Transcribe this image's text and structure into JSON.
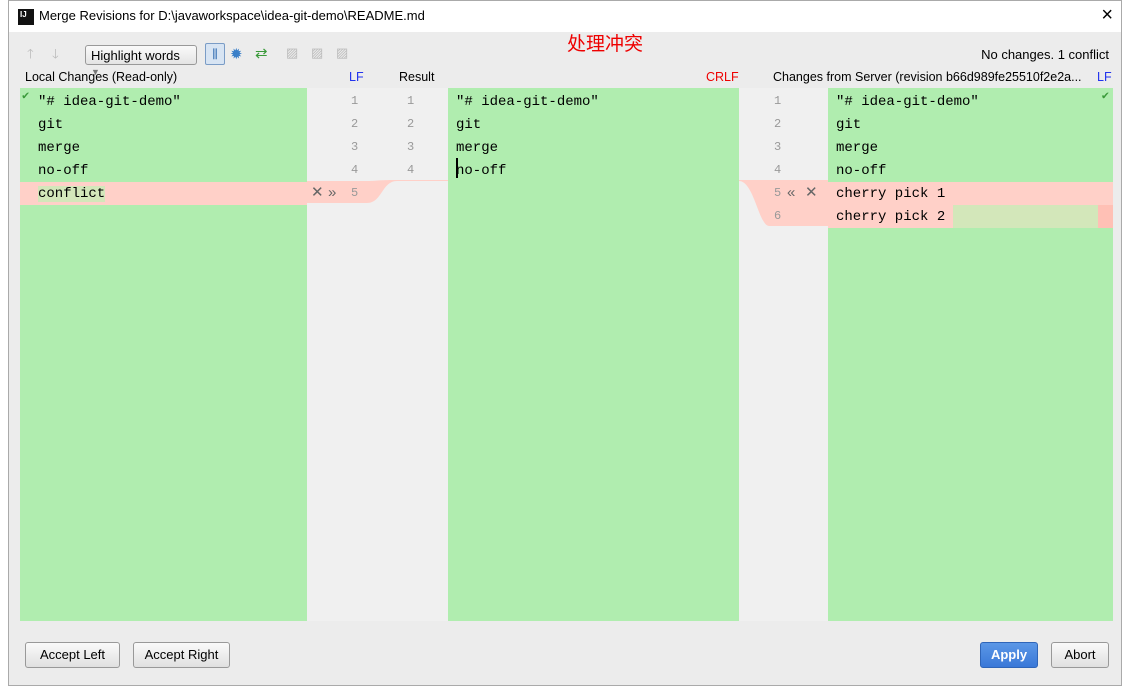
{
  "window": {
    "title": "Merge Revisions for D:\\javaworkspace\\idea-git-demo\\README.md",
    "app_icon": "IJ"
  },
  "toolbar": {
    "highlight_mode": "Highlight words",
    "annotation": "处理冲突",
    "status": "No changes. 1 conflict"
  },
  "panes": {
    "left": {
      "title": "Local Changes (Read-only)",
      "line_ending": "LF",
      "lines": [
        "\"# idea-git-demo\"",
        "git",
        "merge",
        "no-off",
        "conflict"
      ]
    },
    "result": {
      "title": "Result",
      "line_ending": "CRLF",
      "lines": [
        "\"# idea-git-demo\"",
        "git",
        "merge",
        "no-off"
      ]
    },
    "right": {
      "title": "Changes from Server (revision b66d989fe25510f2e2a...",
      "line_ending": "LF",
      "lines": [
        "\"# idea-git-demo\"",
        "git",
        "merge",
        "no-off",
        "cherry pick 1",
        "cherry pick 2"
      ]
    }
  },
  "line_numbers": {
    "left": [
      "1",
      "2",
      "3",
      "4",
      "5"
    ],
    "result": [
      "1",
      "2",
      "3",
      "4"
    ],
    "right": [
      "1",
      "2",
      "3",
      "4",
      "5",
      "6"
    ]
  },
  "buttons": {
    "accept_left": "Accept Left",
    "accept_right": "Accept Right",
    "apply": "Apply",
    "abort": "Abort"
  },
  "colors": {
    "unchanged": "#b0edaf",
    "conflict": "#ffd0c8",
    "accent": "#3a78d8"
  }
}
